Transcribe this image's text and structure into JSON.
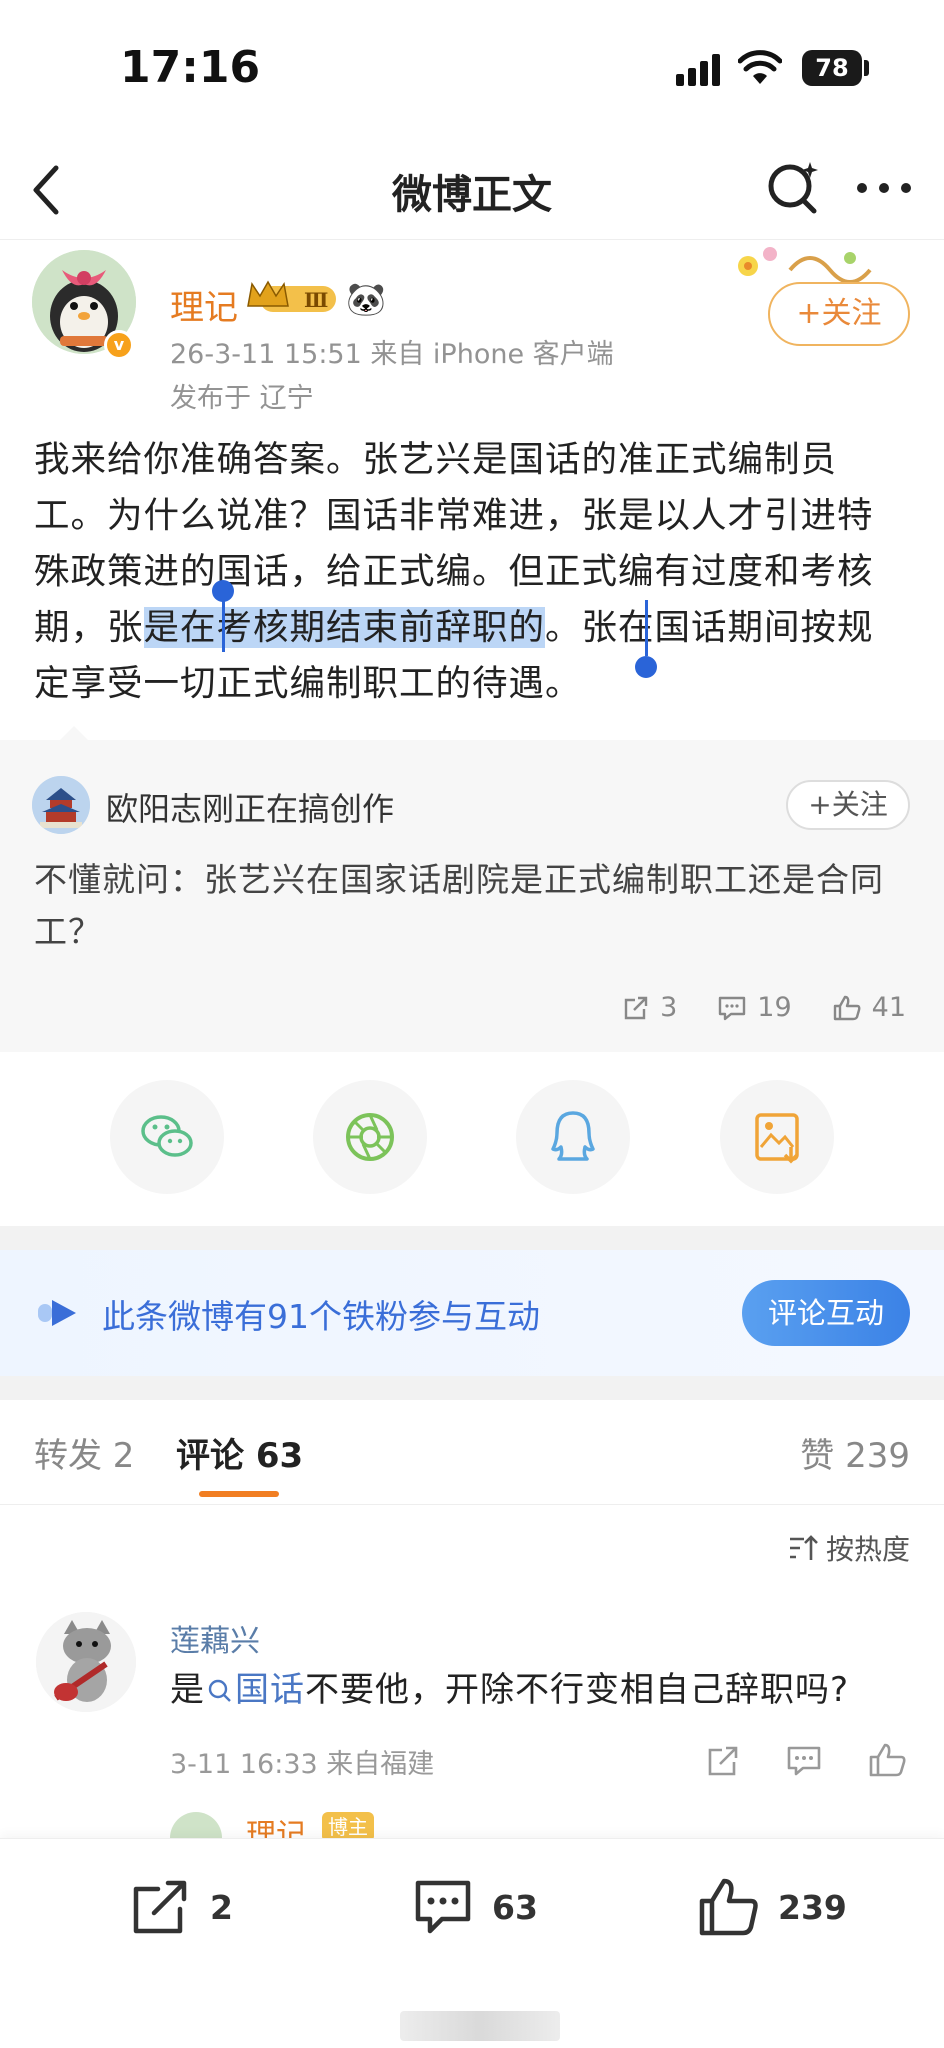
{
  "status_bar": {
    "time": "17:16",
    "battery": "78"
  },
  "nav": {
    "title": "微博正文"
  },
  "post": {
    "author": "理记",
    "badge_level": "Ⅲ",
    "meta": "26-3-11 15:51  来自 iPhone 客户端",
    "location": "发布于 辽宁",
    "follow_label": "+关注",
    "body_before": "我来给你准确答案。张艺兴是国话的准正式编制员工。为什么说准？国话非常难进，张是以人才引进特殊政策进的国话，给正式编。但正式编有过度和考核期，张",
    "body_selected": "是在考核期结束前辞职的",
    "body_after": "。张在国话期间按规定享受一切正式编制职工的待遇。"
  },
  "quoted": {
    "author": "欧阳志刚正在搞创作",
    "follow_label": "+关注",
    "text": "不懂就问：张艺兴在国家话剧院是正式编制职工还是合同工？",
    "reposts": "3",
    "comments": "19",
    "likes": "41"
  },
  "share_targets": [
    "wechat-icon",
    "moments-icon",
    "qq-icon",
    "save-image-icon"
  ],
  "fans_banner": {
    "text": "此条微博有91个铁粉参与互动",
    "button": "评论互动"
  },
  "tabs": {
    "reposts": "转发 2",
    "comments": "评论 63",
    "likes": "赞 239"
  },
  "sort_label": "按热度",
  "comment": {
    "author": "莲藕兴",
    "text_prefix": "是",
    "link_text": "国话",
    "text_suffix": "不要他，开除不行变相自己辞职吗?",
    "meta": "3-11 16:33  来自福建"
  },
  "reply_peek": {
    "author": "理记",
    "badge": "博主"
  },
  "bottom_bar": {
    "reposts": "2",
    "comments": "63",
    "likes": "239"
  },
  "colors": {
    "accent_orange": "#f17e22",
    "link_blue": "#4a77c4",
    "author_orange": "#e57b21",
    "selection": "#bcd6f6"
  }
}
